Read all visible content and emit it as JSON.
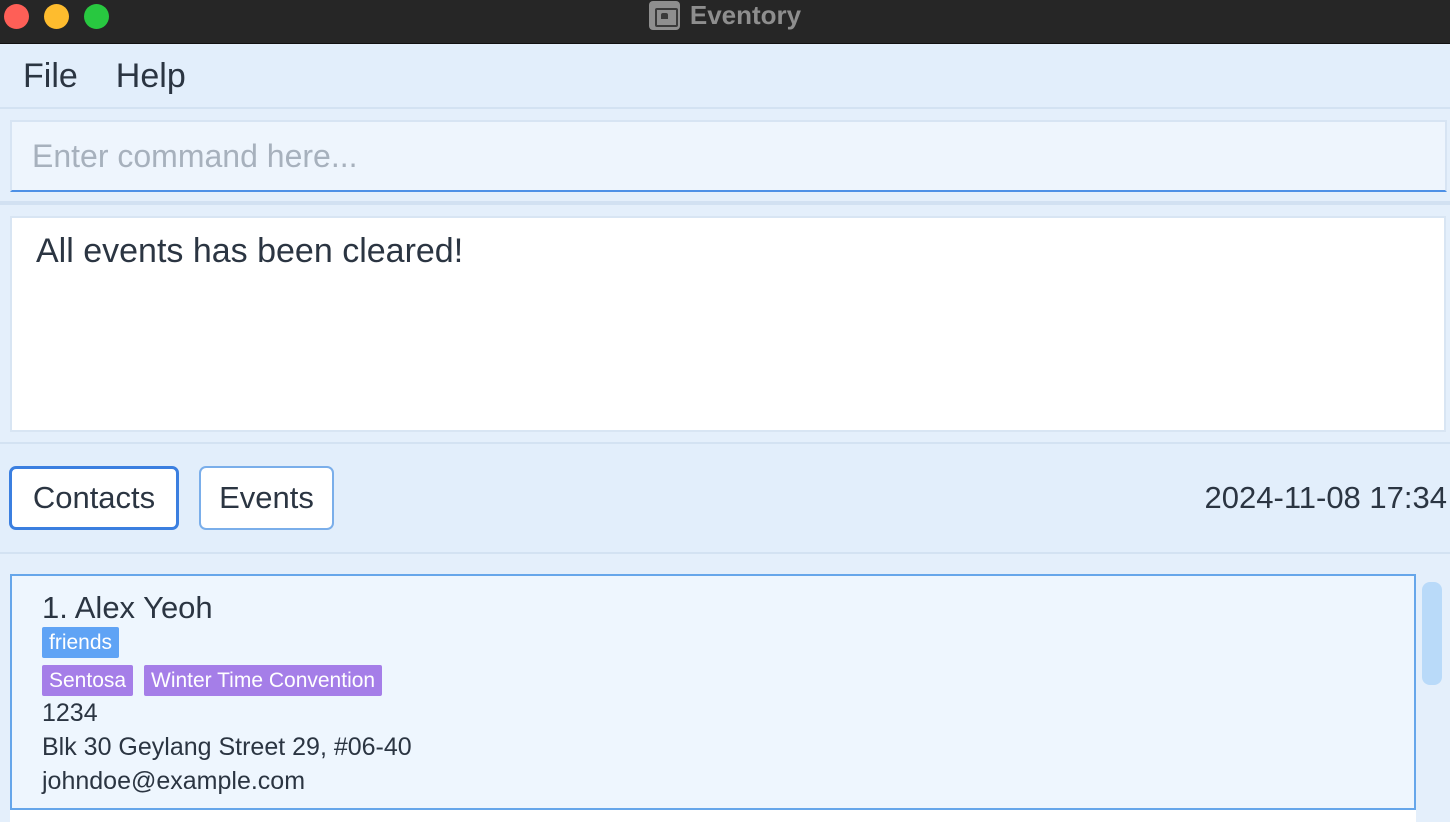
{
  "window": {
    "title": "Eventory",
    "app_icon": "calendar-icon"
  },
  "menu": {
    "items": [
      {
        "label": "File"
      },
      {
        "label": "Help"
      }
    ]
  },
  "command": {
    "placeholder": "Enter command here...",
    "value": ""
  },
  "result": {
    "message": "All events has been cleared!"
  },
  "toggle": {
    "contacts_label": "Contacts",
    "events_label": "Events",
    "datetime": "2024-11-08 17:34"
  },
  "contacts": [
    {
      "index_name": "1. Alex Yeoh",
      "tags": [
        "friends"
      ],
      "events": [
        "Sentosa",
        "Winter Time Convention"
      ],
      "phone": "1234",
      "address": "Blk 30 Geylang Street 29, #06-40",
      "email": "johndoe@example.com"
    }
  ],
  "colors": {
    "accent": "#3b7fe0",
    "tag_blue": "#5fa3f5",
    "tag_purple": "#a57ee8",
    "background": "#e4effb"
  }
}
